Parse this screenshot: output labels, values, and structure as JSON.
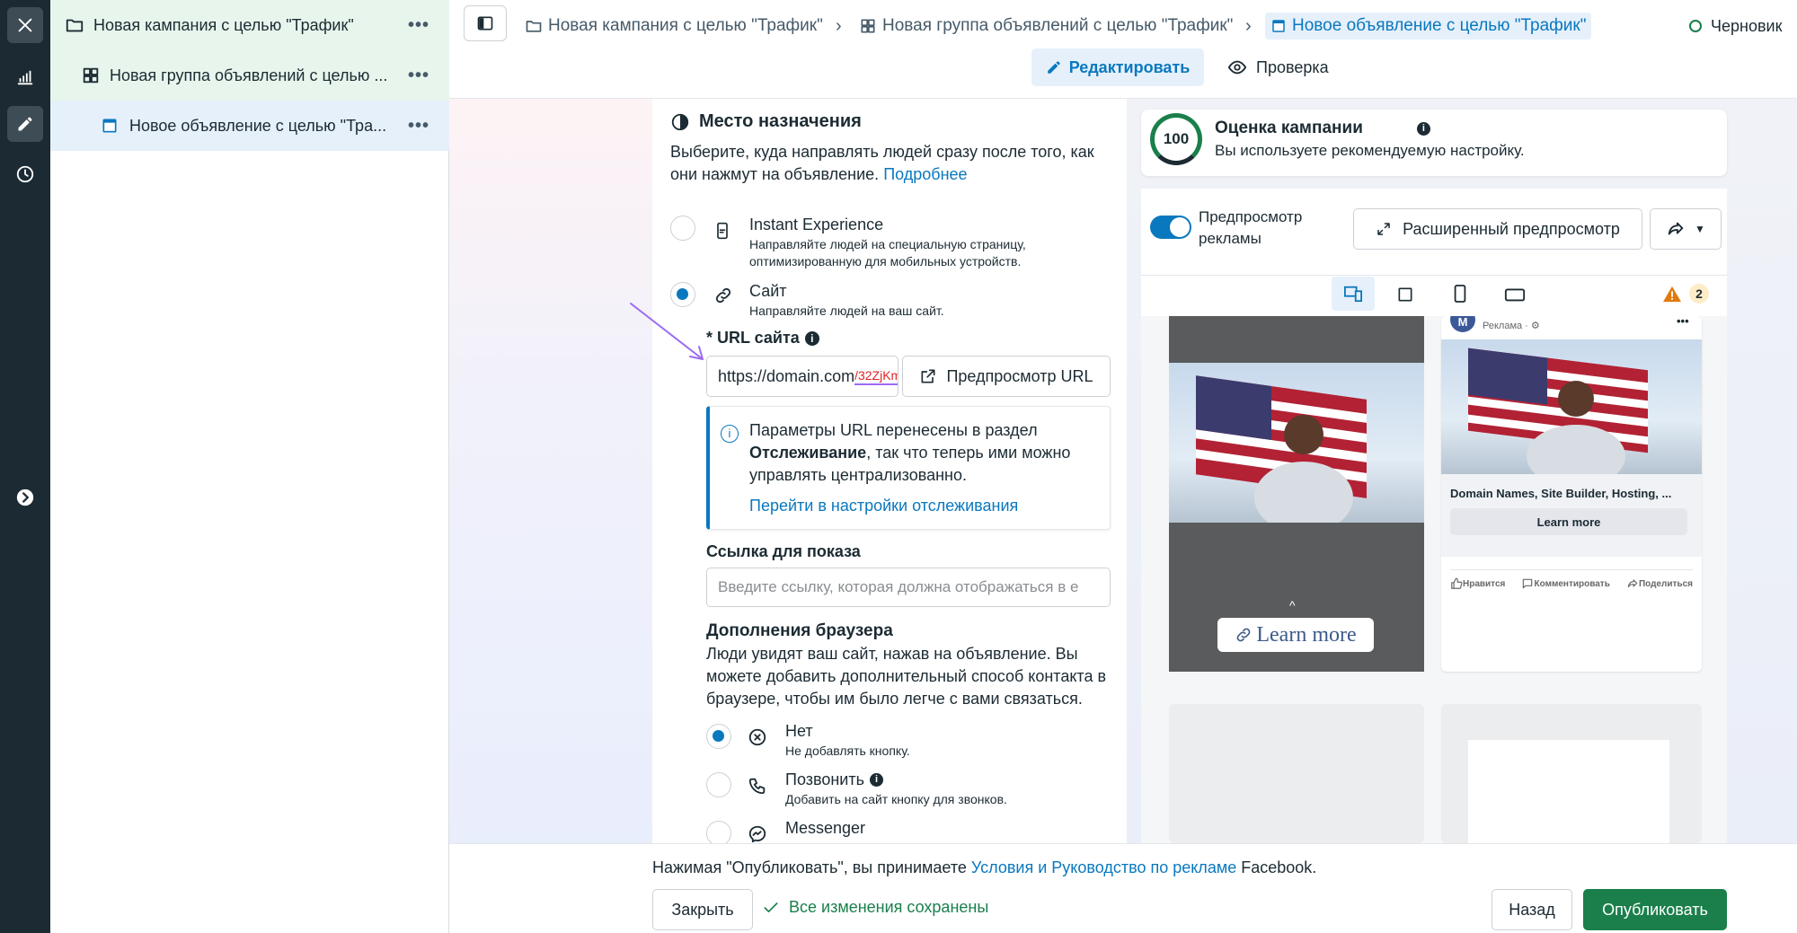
{
  "tree": {
    "campaign": "Новая кампания с целью \"Трафик\"",
    "adset": "Новая группа объявлений с целью ...",
    "ad": "Новое объявление с целью \"Тра...",
    "more": "•••"
  },
  "breadcrumbs": {
    "campaign": "Новая кампания с целью \"Трафик\"",
    "adset": "Новая группа объявлений с целью \"Трафик\"",
    "ad": "Новое объявление с целью \"Трафик\"",
    "sep": "›",
    "status": "Черновик"
  },
  "mode_tabs": {
    "edit": "Редактировать",
    "review": "Проверка"
  },
  "destination": {
    "title": "Место назначения",
    "desc": "Выберите, куда направлять людей сразу после того, как они нажмут на объявление.",
    "more_link": "Подробнее",
    "options": [
      {
        "title": "Instant Experience",
        "desc1": "Направляйте людей на специальную страницу,",
        "desc2": "оптимизированную для мобильных устройств."
      },
      {
        "title": "Сайт",
        "desc1": "Направляйте людей на ваш сайт.",
        "desc2": ""
      }
    ]
  },
  "url": {
    "label": "* URL сайта",
    "value": "https://domain.com",
    "suffix": "/32ZjKm",
    "preview_btn": "Предпросмотр URL",
    "info_line1": "Параметры URL перенесены в раздел",
    "info_bold": "Отслеживание",
    "info_line2_rest": ", так что теперь ими можно",
    "info_line3": "управлять централизованно.",
    "info_link": "Перейти в настройки отслеживания"
  },
  "display_link": {
    "label": "Ссылка для показа",
    "placeholder": "Введите ссылку, которая должна отображаться в е"
  },
  "browser_addons": {
    "title": "Дополнения браузера",
    "desc_l1": "Люди увидят ваш сайт, нажав на объявление. Вы",
    "desc_l2": "можете добавить дополнительный способ контакта в",
    "desc_l3": "браузере, чтобы им было легче с вами связаться.",
    "options": [
      {
        "title": "Нет",
        "desc": "Не добавлять кнопку."
      },
      {
        "title": "Позвонить",
        "desc": "Добавить на сайт кнопку для звонков."
      },
      {
        "title": "Messenger",
        "desc": ""
      }
    ]
  },
  "score": {
    "value": "100",
    "title": "Оценка кампании",
    "desc": "Вы используете рекомендуемую настройку."
  },
  "preview": {
    "toggle_l1": "Предпросмотр",
    "toggle_l2": "рекламы",
    "advanced_btn": "Расширенный предпросмотр",
    "warn_count": "2",
    "story_cta": "Learn more",
    "feed_sponsored": "Реклама · ⚙",
    "feed_avatar": "M",
    "feed_headline": "Domain Names, Site Builder, Hosting, ...",
    "feed_cta": "Learn more",
    "like": "Нравится",
    "comment": "Комментировать",
    "share": "Поделиться",
    "more": "•••"
  },
  "footer": {
    "terms_prefix": "Нажимая \"Опубликовать\", вы принимаете ",
    "terms_link1": "Условия",
    "terms_and": " и ",
    "terms_link2": "Руководство по рекламе",
    "terms_suffix": " Facebook.",
    "close": "Закрыть",
    "saved": "Все изменения сохранены",
    "back": "Назад",
    "publish": "Опубликовать"
  },
  "colors": {
    "accent": "#0a78be",
    "publish": "#1a7f4b",
    "rail": "#1c2b33",
    "url_suffix": "#e02424",
    "arrow": "#9b6bf5"
  }
}
